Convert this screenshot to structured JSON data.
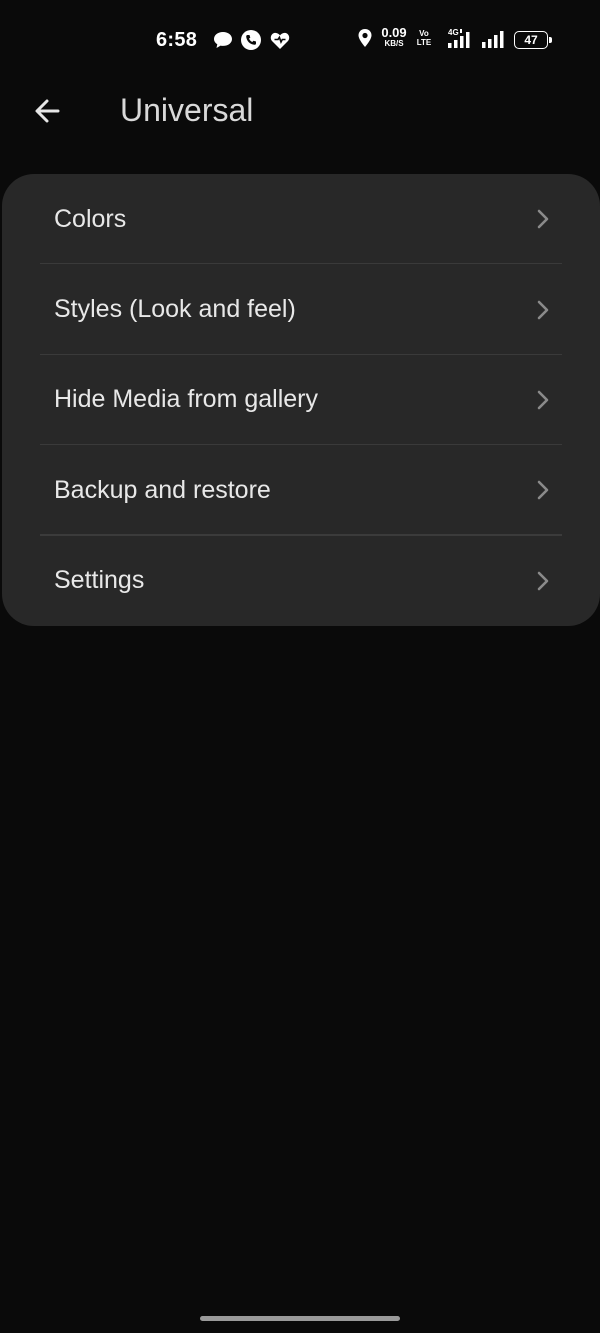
{
  "status_bar": {
    "time": "6:58",
    "net_speed_value": "0.09",
    "net_speed_unit": "KB/S",
    "volte_line1": "Vo",
    "volte_line2": "LTE",
    "network_type": "4G",
    "battery": "47",
    "notification_icons": [
      "chat-bubble-icon",
      "phone-call-icon",
      "heart-app-icon"
    ],
    "indicator_icons": [
      "location-icon",
      "signal-4g-icon",
      "signal-bars-icon",
      "battery-icon"
    ]
  },
  "app_bar": {
    "title": "Universal",
    "back_icon": "arrow-left-icon"
  },
  "menu": {
    "items": [
      {
        "label": "Colors"
      },
      {
        "label": "Styles (Look and feel)"
      },
      {
        "label": "Hide Media from gallery"
      },
      {
        "label": "Backup and restore"
      },
      {
        "label": "Settings"
      }
    ],
    "chevron_icon": "chevron-right-icon"
  },
  "colors": {
    "background": "#0a0a0a",
    "card": "#282828",
    "text": "#e8e8e8",
    "chevron": "#8a8a8a"
  }
}
